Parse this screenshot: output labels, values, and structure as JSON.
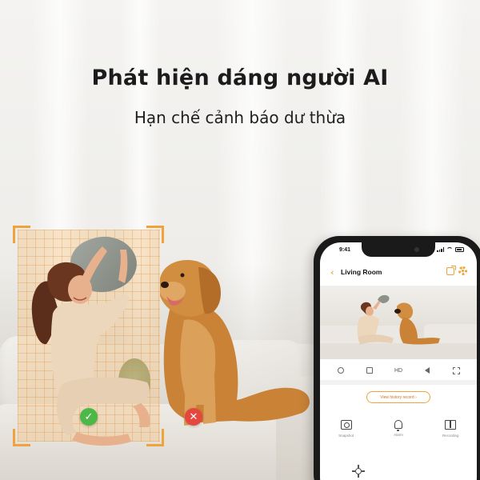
{
  "headline": "Phát hiện dáng người AI",
  "subline": "Hạn chế cảnh báo dư thừa",
  "detection": {
    "accent_color": "#f0a33c",
    "person_badge_icon": "check-icon",
    "person_badge_glyph": "✓",
    "pet_badge_icon": "cross-icon",
    "pet_badge_glyph": "✕",
    "ok_color": "#4db848",
    "no_color": "#e5473f"
  },
  "phone": {
    "time": "9:41",
    "room_title": "Living Room",
    "back_glyph": "‹",
    "controls": [
      "record-icon",
      "screenshot-small-icon",
      "HD",
      "sound-icon",
      "fullscreen-icon"
    ],
    "hd_label": "HD",
    "history_button": "View history record ›",
    "features": [
      {
        "icon": "camera-icon",
        "label": "Snapshot"
      },
      {
        "icon": "bell-icon",
        "label": "Alarm"
      },
      {
        "icon": "album-icon",
        "label": "Recording"
      }
    ]
  }
}
